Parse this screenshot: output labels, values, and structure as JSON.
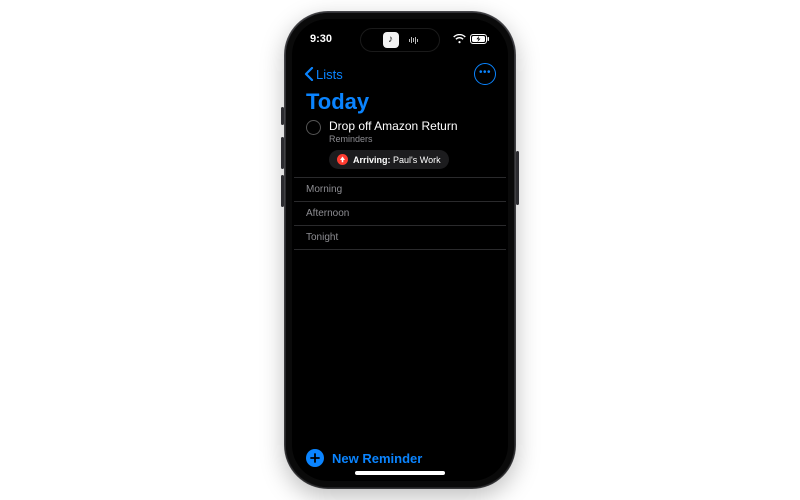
{
  "status": {
    "time": "9:30"
  },
  "nav": {
    "back_label": "Lists"
  },
  "page": {
    "title": "Today"
  },
  "reminders": [
    {
      "title": "Drop off Amazon Return",
      "list_name": "Reminders",
      "location_prefix": "Arriving:",
      "location_name": "Paul's Work"
    }
  ],
  "sections": {
    "morning": "Morning",
    "afternoon": "Afternoon",
    "tonight": "Tonight"
  },
  "bottom": {
    "new_reminder": "New Reminder"
  }
}
